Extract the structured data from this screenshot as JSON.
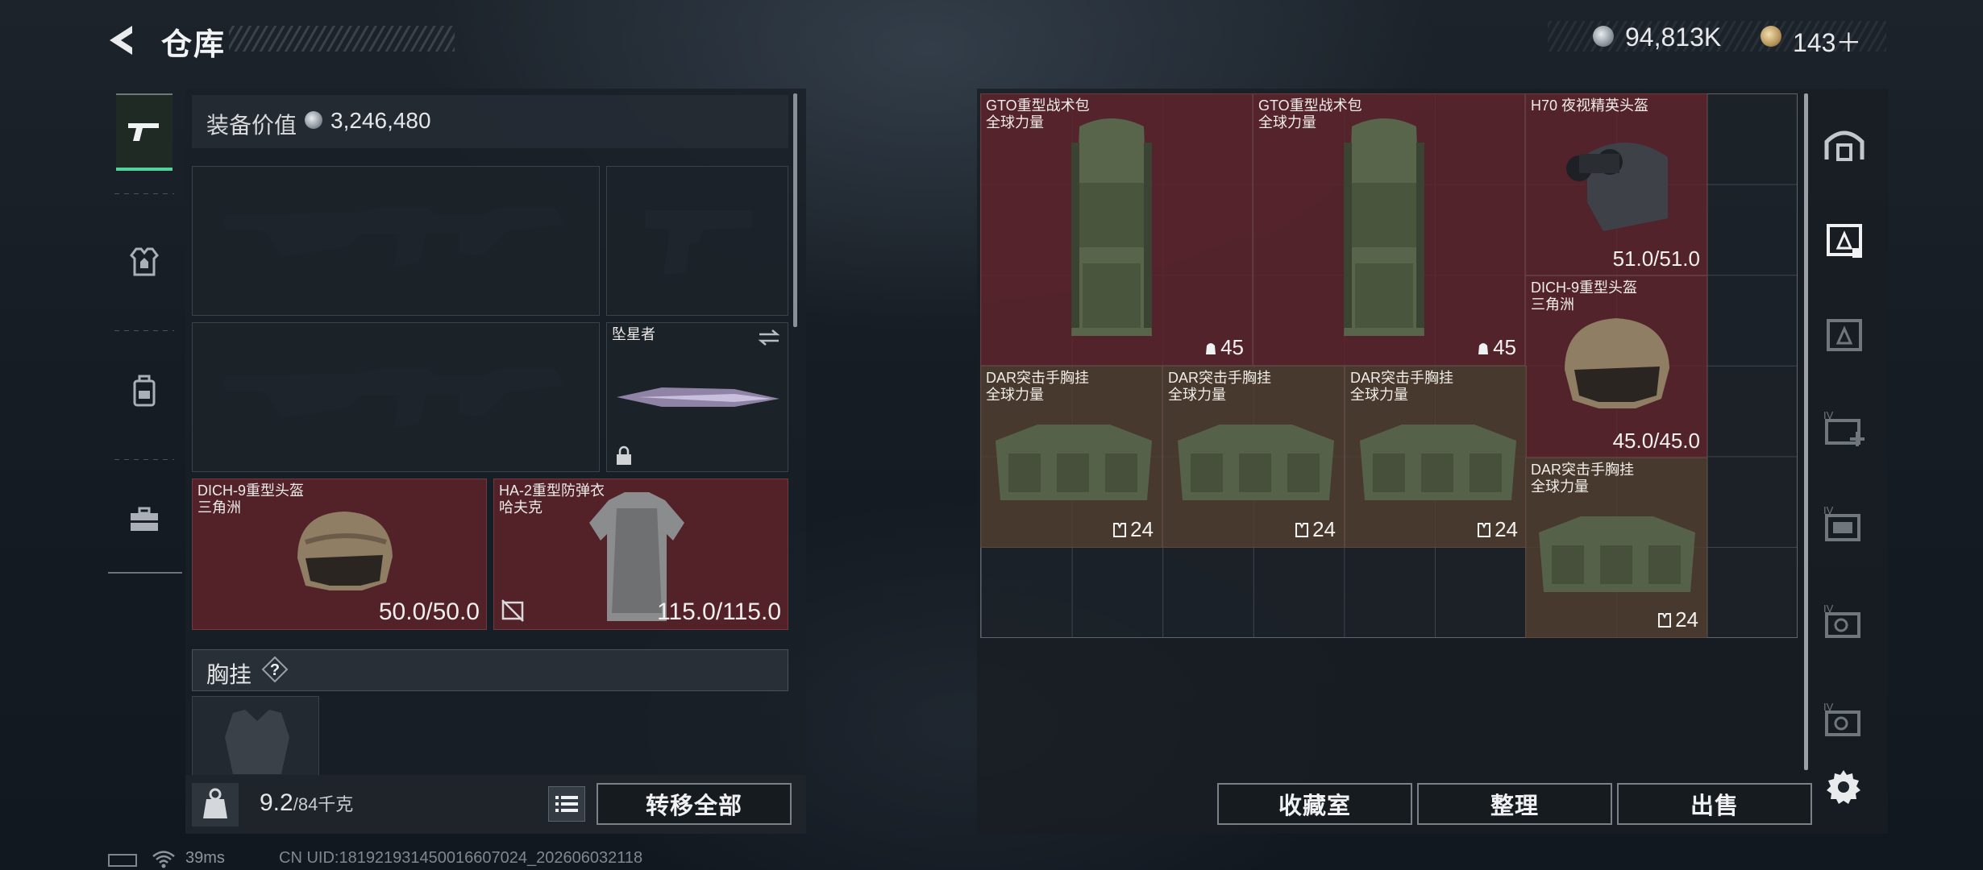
{
  "header": {
    "title": "仓库",
    "silver": "94,813K",
    "gold": "143＋"
  },
  "equipment": {
    "value_label": "装备价值",
    "value": "3,246,480",
    "melee": {
      "name": "坠星者"
    },
    "helmet": {
      "name": "DICH-9重型头盔",
      "sub": "三角洲",
      "durability": "50.0/50.0"
    },
    "armor": {
      "name": "HA-2重型防弹衣",
      "sub": "哈夫克",
      "durability": "115.0/115.0"
    },
    "chest_label": "胸挂",
    "chest_help": "?"
  },
  "weight": {
    "current": "9.2",
    "max": "/84千克"
  },
  "buttons": {
    "transfer_all": "转移全部",
    "vault": "收藏室",
    "sort": "整理",
    "sell": "出售"
  },
  "stash": {
    "items": [
      {
        "name": "GTO重型战术包",
        "sub": "全球力量",
        "capacity": "45",
        "color": "#60232c"
      },
      {
        "name": "GTO重型战术包",
        "sub": "全球力量",
        "capacity": "45",
        "color": "#60232c"
      },
      {
        "name": "H70 夜视精英头盔",
        "sub": "",
        "durability": "51.0/51.0",
        "color": "#60232c"
      },
      {
        "name": "DICH-9重型头盔",
        "sub": "三角洲",
        "durability": "45.0/45.0",
        "color": "#60232c"
      },
      {
        "name": "DAR突击手胸挂",
        "sub": "全球力量",
        "capacity": "24",
        "color": "#523e30"
      },
      {
        "name": "DAR突击手胸挂",
        "sub": "全球力量",
        "capacity": "24",
        "color": "#523e30"
      },
      {
        "name": "DAR突击手胸挂",
        "sub": "全球力量",
        "capacity": "24",
        "color": "#523e30"
      },
      {
        "name": "DAR突击手胸挂",
        "sub": "全球力量",
        "capacity": "24",
        "color": "#523e30"
      }
    ]
  },
  "footer": {
    "ping": "39ms",
    "uid": "CN UID:181921931450016607024_202606032118"
  }
}
